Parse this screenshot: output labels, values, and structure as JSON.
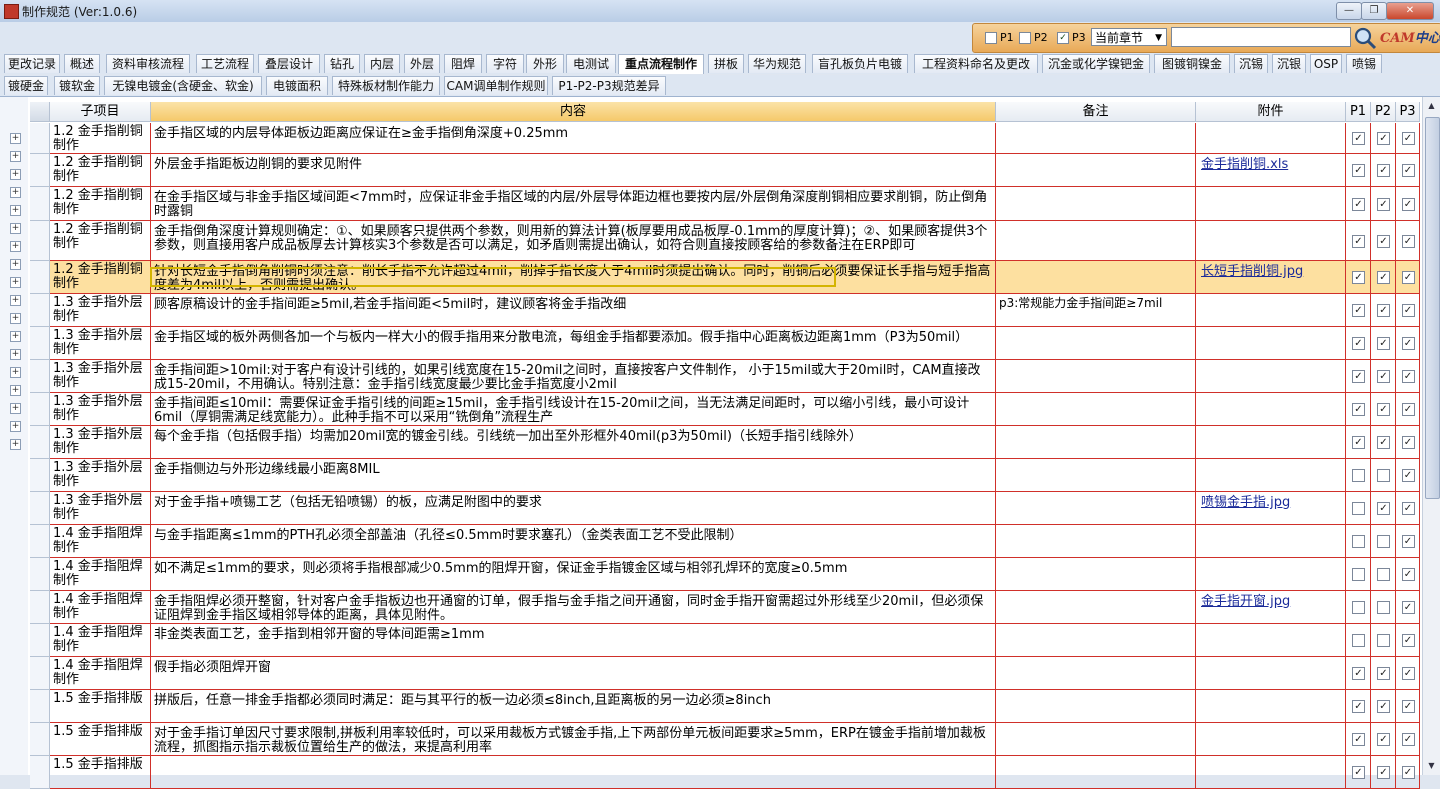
{
  "window": {
    "title": "制作规范 (Ver:1.0.6)",
    "min": "—",
    "max": "❐",
    "close": "✕"
  },
  "filter": {
    "p1_label": "P1",
    "p1_checked": false,
    "p2_label": "P2",
    "p2_checked": false,
    "p3_label": "P3",
    "p3_checked": true,
    "chapter_select": "当前章节",
    "search_value": "",
    "logo_a": "CAM",
    "logo_b": "中心"
  },
  "tabs_row1": [
    "更改记录",
    "概述",
    "资料审核流程",
    "工艺流程",
    "叠层设计",
    "钻孔",
    "内层",
    "外层",
    "阻焊",
    "字符",
    "外形",
    "电测试",
    "重点流程制作",
    "拼板",
    "华为规范",
    "盲孔板负片电镀",
    "工程资料命名及更改",
    "沉金或化学镍钯金",
    "图镀铜镍金",
    "沉锡",
    "沉银",
    "OSP",
    "喷锡"
  ],
  "tabs_row2": [
    "镀硬金",
    "镀软金",
    "无镍电镀金(含硬金、软金)",
    "电镀面积",
    "特殊板材制作能力",
    "CAM调单制作规则",
    "P1-P2-P3规范差异"
  ],
  "active_tab": "重点流程制作",
  "grid": {
    "headers": {
      "sub": "子项目",
      "content": "内容",
      "note": "备注",
      "att": "附件",
      "p1": "P1",
      "p2": "P2",
      "p3": "P3"
    },
    "rows": [
      {
        "sub": "1.2 金手指削铜制作",
        "content": "金手指区域的内层导体距板边距离应保证在≥金手指倒角深度+0.25mm",
        "note": "",
        "att": "",
        "p1": true,
        "p2": true,
        "p3": true
      },
      {
        "sub": "1.2 金手指削铜制作",
        "content": "外层金手指距板边削铜的要求见附件",
        "note": "",
        "att": "金手指削铜.xls",
        "p1": true,
        "p2": true,
        "p3": true
      },
      {
        "sub": "1.2 金手指削铜制作",
        "content": "在金手指区域与非金手指区域间距<7mm时，应保证非金手指区域的内层/外层导体距边框也要按内层/外层倒角深度削铜相应要求削铜，防止倒角时露铜",
        "note": "",
        "att": "",
        "p1": true,
        "p2": true,
        "p3": true
      },
      {
        "sub": "1.2 金手指削铜制作",
        "content": "金手指倒角深度计算规则确定：①、如果顾客只提供两个参数，则用新的算法计算(板厚要用成品板厚-0.1mm的厚度计算)；②、如果顾客提供3个参数，则直接用客户成品板厚去计算核实3个参数是否可以满足，如矛盾则需提出确认，如符合则直接按顾客给的参数备注在ERP即可",
        "note": "",
        "att": "",
        "p1": true,
        "p2": true,
        "p3": true
      },
      {
        "sub": "1.2 金手指削铜制作",
        "content": "针对长短金手指倒角削铜时须注意：削长手指不允许超过4mil，削掉手指长度大于4mil时须提出确认。同时，削铜后必须要保证长手指与短手指高度差为4mil以上，否则需提出确认。",
        "note": "",
        "att": "长短手指削铜.jpg",
        "p1": true,
        "p2": true,
        "p3": true
      },
      {
        "sub": "1.3 金手指外层制作",
        "content": "顾客原稿设计的金手指间距≥5mil,若金手指间距<5mil时，建议顾客将金手指改细",
        "note": "p3:常规能力金手指间距≥7mil",
        "att": "",
        "p1": true,
        "p2": true,
        "p3": true
      },
      {
        "sub": "1.3 金手指外层制作",
        "content": "金手指区域的板外两侧各加一个与板内一样大小的假手指用来分散电流，每组金手指都要添加。假手指中心距离板边距离1mm（P3为50mil）",
        "note": "",
        "att": "",
        "p1": true,
        "p2": true,
        "p3": true
      },
      {
        "sub": "1.3 金手指外层制作",
        "content": "金手指间距>10mil:对于客户有设计引线的，如果引线宽度在15-20mil之间时，直接按客户文件制作， 小于15mil或大于20mil时，CAM直接改成15-20mil，不用确认。特别注意：金手指引线宽度最少要比金手指宽度小2mil",
        "note": "",
        "att": "",
        "p1": true,
        "p2": true,
        "p3": true
      },
      {
        "sub": "1.3 金手指外层制作",
        "content": "金手指间距≤10mil：需要保证金手指引线的间距≥15mil，金手指引线设计在15-20mil之间，当无法满足间距时，可以缩小引线，最小可设计6mil（厚铜需满足线宽能力）。此种手指不可以采用“铣倒角”流程生产",
        "note": "",
        "att": "",
        "p1": true,
        "p2": true,
        "p3": true
      },
      {
        "sub": "1.3 金手指外层制作",
        "content": "每个金手指（包括假手指）均需加20mil宽的镀金引线。引线统一加出至外形框外40mil(p3为50mil)（长短手指引线除外）",
        "note": "",
        "att": "",
        "p1": true,
        "p2": true,
        "p3": true
      },
      {
        "sub": "1.3 金手指外层制作",
        "content": "金手指侧边与外形边缘线最小距离8MIL",
        "note": "",
        "att": "",
        "p1": false,
        "p2": false,
        "p3": true
      },
      {
        "sub": "1.3 金手指外层制作",
        "content": "对于金手指+喷锡工艺（包括无铅喷锡）的板，应满足附图中的要求",
        "note": "",
        "att": "喷锡金手指.jpg",
        "p1": false,
        "p2": true,
        "p3": true
      },
      {
        "sub": "1.4 金手指阻焊制作",
        "content": "与金手指距离≤1mm的PTH孔必须全部盖油（孔径≤0.5mm时要求塞孔）（金类表面工艺不受此限制）",
        "note": "",
        "att": "",
        "p1": false,
        "p2": false,
        "p3": true
      },
      {
        "sub": "1.4 金手指阻焊制作",
        "content": "如不满足≤1mm的要求，则必须将手指根部减少0.5mm的阻焊开窗，保证金手指镀金区域与相邻孔焊环的宽度≥0.5mm",
        "note": "",
        "att": "",
        "p1": false,
        "p2": false,
        "p3": true
      },
      {
        "sub": "1.4 金手指阻焊制作",
        "content": "金手指阻焊必须开整窗，针对客户金手指板边也开通窗的订单，假手指与金手指之间开通窗，同时金手指开窗需超过外形线至少20mil，但必须保证阻焊到金手指区域相邻导体的距离，具体见附件。",
        "note": "",
        "att": "金手指开窗.jpg",
        "p1": false,
        "p2": false,
        "p3": true
      },
      {
        "sub": "1.4 金手指阻焊制作",
        "content": "非金类表面工艺，金手指到相邻开窗的导体间距需≥1mm",
        "note": "",
        "att": "",
        "p1": false,
        "p2": false,
        "p3": true
      },
      {
        "sub": "1.4 金手指阻焊制作",
        "content": "假手指必须阻焊开窗",
        "note": "",
        "att": "",
        "p1": true,
        "p2": true,
        "p3": true
      },
      {
        "sub": "1.5 金手指排版",
        "content": "拼版后，任意一排金手指都必须同时满足：距与其平行的板一边必须≤8inch,且距离板的另一边必须≥8inch",
        "note": "",
        "att": "",
        "p1": true,
        "p2": true,
        "p3": true
      },
      {
        "sub": "1.5 金手指排版",
        "content": "对于金手指订单因尺寸要求限制,拼板利用率较低时，可以采用裁板方式镀金手指,上下两部份单元板间距要求≥5mm，ERP在镀金手指前增加裁板流程，抓图指示指示裁板位置给生产的做法，来提高利用率",
        "note": "",
        "att": "",
        "p1": true,
        "p2": true,
        "p3": true
      },
      {
        "sub": "1.5 金手指排版",
        "content": "",
        "note": "",
        "att": "",
        "p1": true,
        "p2": true,
        "p3": true
      }
    ]
  }
}
